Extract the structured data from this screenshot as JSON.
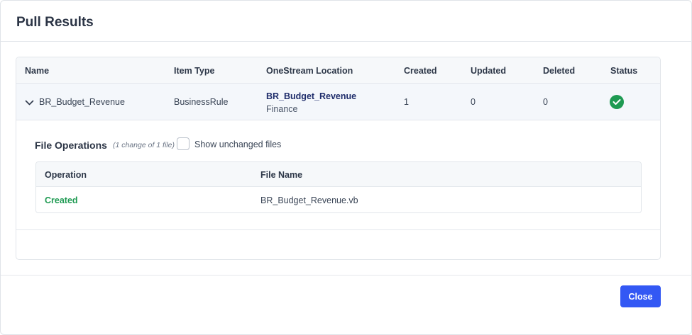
{
  "dialog": {
    "title": "Pull Results"
  },
  "results": {
    "columns": [
      "Name",
      "Item Type",
      "OneStream Location",
      "Created",
      "Updated",
      "Deleted",
      "Status"
    ],
    "rows": [
      {
        "name": "BR_Budget_Revenue",
        "item_type": "BusinessRule",
        "location": {
          "name": "BR_Budget_Revenue",
          "sub": "Finance"
        },
        "created": "1",
        "updated": "0",
        "deleted": "0",
        "status": "success",
        "status_icon": "check-circle-icon",
        "expanded": true
      }
    ]
  },
  "file_operations": {
    "title": "File Operations",
    "summary": "(1 change of 1 file)",
    "show_unchanged_label": "Show unchanged files",
    "show_unchanged_checked": false,
    "columns": [
      "Operation",
      "File Name"
    ],
    "rows": [
      {
        "operation": "Created",
        "file_name": "BR_Budget_Revenue.vb"
      }
    ]
  },
  "footer": {
    "close_label": "Close"
  },
  "colors": {
    "primary": "#3358f4",
    "success": "#1e9a52",
    "location_link": "#1f2d6b"
  }
}
